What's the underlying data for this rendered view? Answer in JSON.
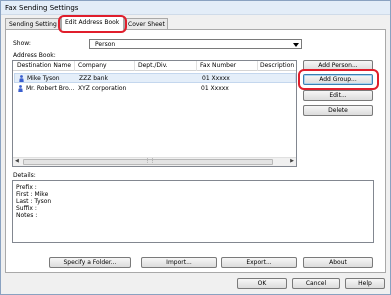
{
  "window": {
    "title": "Fax Sending Settings"
  },
  "tabs": [
    {
      "label": "Sending Setting"
    },
    {
      "label": "Edit Address Book"
    },
    {
      "label": "Cover Sheet"
    }
  ],
  "show": {
    "label": "Show:",
    "selected": "Person"
  },
  "address_book": {
    "label": "Address Book:",
    "columns": [
      "Destination Name",
      "Company",
      "Dept./Div.",
      "Fax Number",
      "Description"
    ],
    "rows": [
      {
        "name": "Mike Tyson",
        "company": "ZZZ bank",
        "dept": "",
        "fax": "01 Xxxxx",
        "description": ""
      },
      {
        "name": "Mr. Robert Bro...",
        "company": "XYZ corporation",
        "dept": "",
        "fax": "01 Xxxxx",
        "description": ""
      }
    ]
  },
  "side_buttons": {
    "add_person": "Add Person...",
    "add_group": "Add Group...",
    "edit": "Edit...",
    "delete": "Delete"
  },
  "details": {
    "label": "Details:",
    "lines": [
      "Prefix :",
      "First    : Mike",
      "Last    : Tyson",
      "Suffix :",
      "Notes :"
    ]
  },
  "bottom_buttons": {
    "specify_folder": "Specify a Folder...",
    "import": "Import...",
    "export": "Export...",
    "about": "About"
  },
  "dialog_buttons": {
    "ok": "OK",
    "cancel": "Cancel",
    "help": "Help"
  },
  "colors": {
    "highlight_ring": "#e01e2c",
    "selected_row": "#e4eef9",
    "person_icon": "#3a5fcf"
  }
}
